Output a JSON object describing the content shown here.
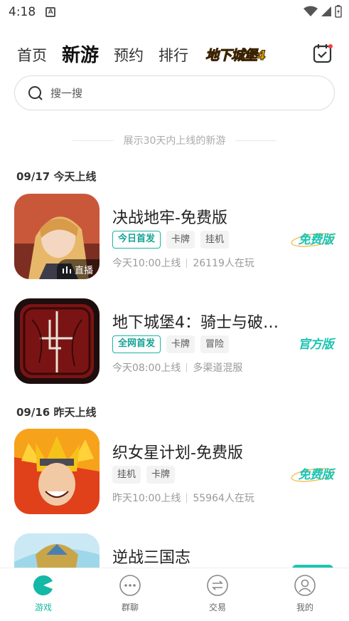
{
  "status_bar": {
    "time": "4:18",
    "notification_icon": "A"
  },
  "top_nav": {
    "tabs": [
      {
        "label": "首页",
        "active": false
      },
      {
        "label": "新游",
        "active": true
      },
      {
        "label": "预约",
        "active": false
      },
      {
        "label": "排行",
        "active": false
      }
    ],
    "logo_text": "地下城堡4",
    "calendar_icon": "calendar-check-icon"
  },
  "search": {
    "placeholder": "搜一搜"
  },
  "caption": "展示30天内上线的新游",
  "sections": [
    {
      "header": "09/17 今天上线"
    },
    {
      "header": "09/16 昨天上线"
    }
  ],
  "games": [
    {
      "title": "决战地牢-免费版",
      "tags": [
        "今日首发",
        "卡牌",
        "挂机"
      ],
      "meta_time": "今天10:00上线",
      "meta_info": "26119人在玩",
      "badge": "免费版",
      "live_label": "直播"
    },
    {
      "title": "地下城堡4：骑士与破…",
      "tags": [
        "全网首发",
        "卡牌",
        "冒险"
      ],
      "meta_time": "今天08:00上线",
      "meta_info": "多渠道混服",
      "badge": "官方版"
    },
    {
      "title": "织女星计划-免费版",
      "tags": [
        "挂机",
        "卡牌"
      ],
      "meta_time": "昨天10:00上线",
      "meta_info": "55964人在玩",
      "badge": "免费版"
    },
    {
      "title": "逆战三国志"
    }
  ],
  "bottom_nav": [
    {
      "label": "游戏",
      "icon": "pacman-icon",
      "active": true
    },
    {
      "label": "群聊",
      "icon": "chat-dots-icon",
      "active": false
    },
    {
      "label": "交易",
      "icon": "exchange-icon",
      "active": false
    },
    {
      "label": "我的",
      "icon": "user-icon",
      "active": false
    }
  ],
  "colors": {
    "accent": "#14b8a6",
    "badge": "#1cc4b2",
    "tag_border": "#1ab3a3"
  }
}
